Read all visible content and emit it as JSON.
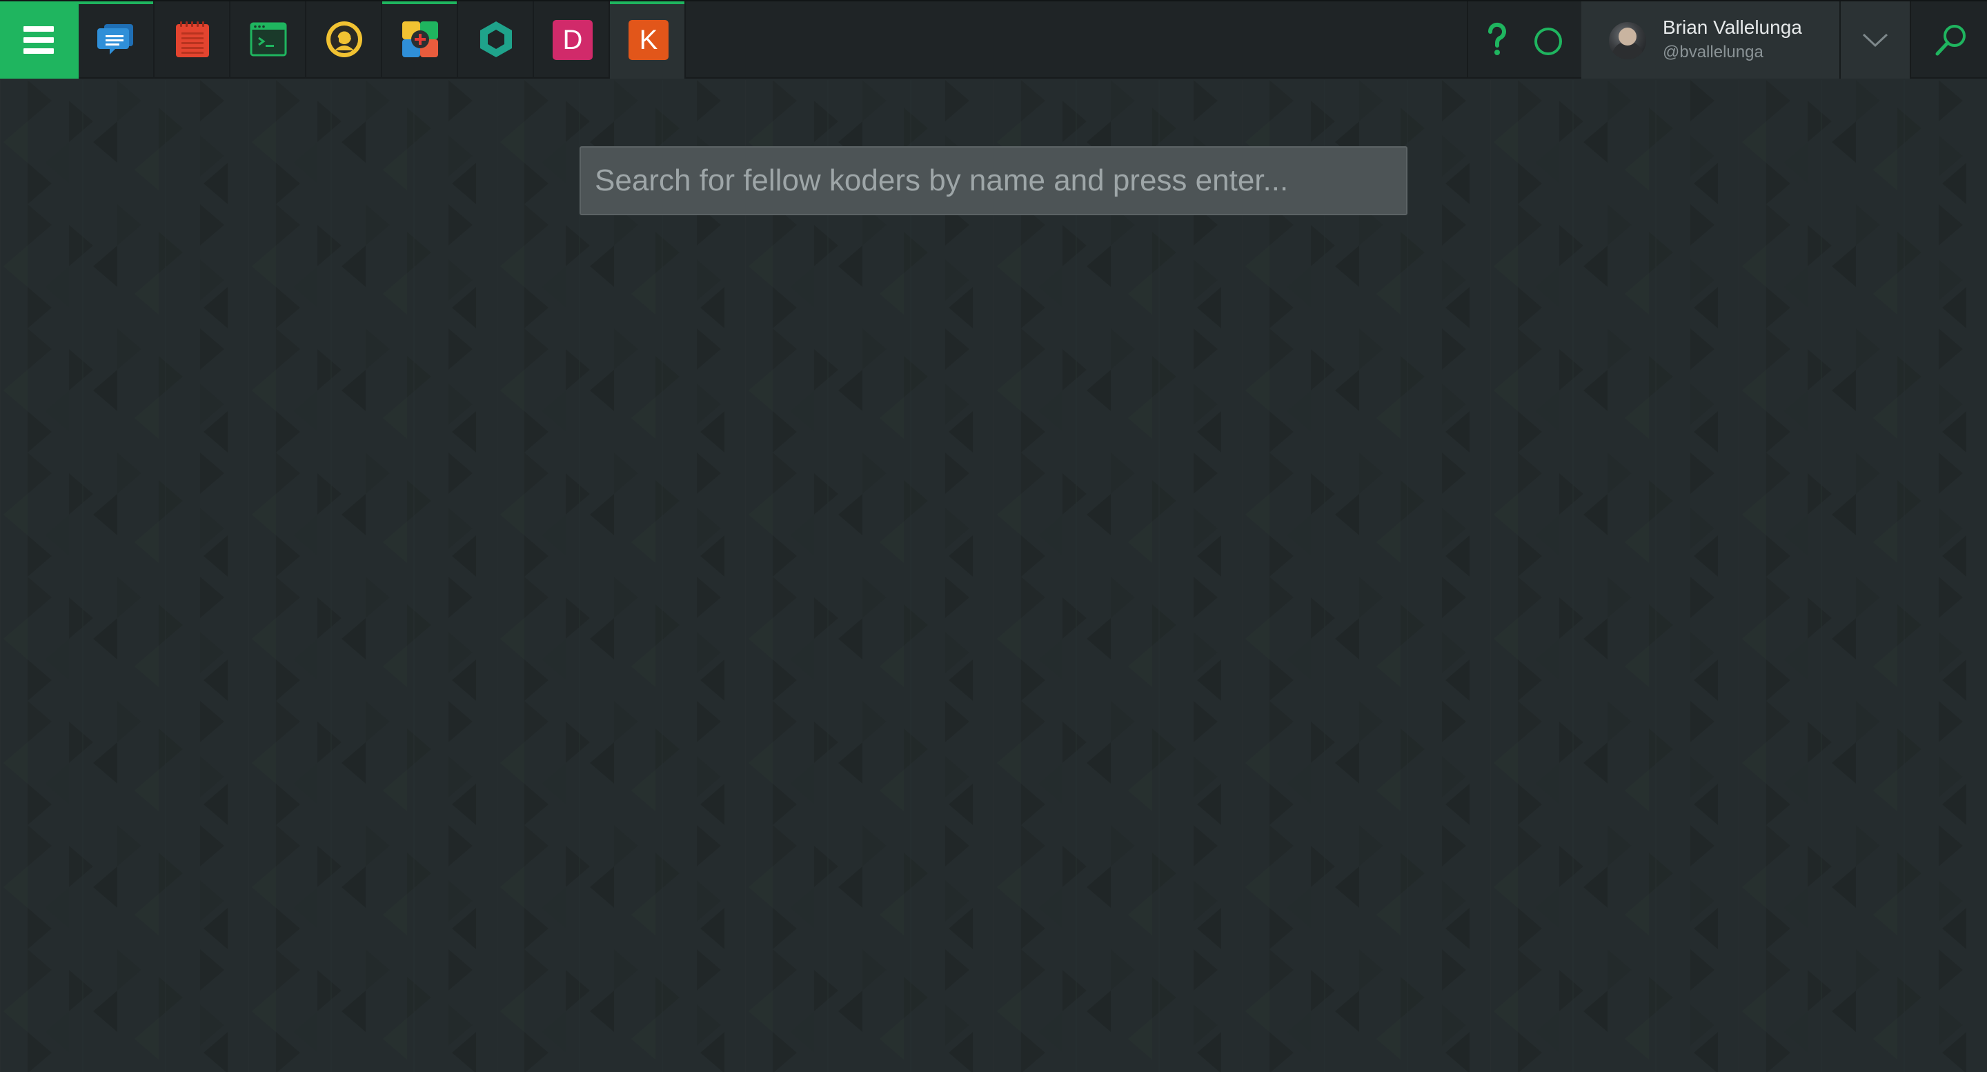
{
  "app": {
    "accent_color": "#1fb55f",
    "background_color": "#252c2e",
    "topbar_color": "#1f2426"
  },
  "menu": {
    "icon": "hamburger-menu-icon"
  },
  "apps": [
    {
      "name": "chat",
      "icon": "chat-bubble-icon",
      "color": "#2f8fd8",
      "active_line": true
    },
    {
      "name": "notes",
      "icon": "notepad-icon",
      "color": "#e3442f",
      "active_line": false
    },
    {
      "name": "terminal",
      "icon": "terminal-icon",
      "color": "#1fb55f",
      "active_line": false
    },
    {
      "name": "support",
      "icon": "headset-person-icon",
      "color": "#f1c232",
      "active_line": false
    },
    {
      "name": "add-app",
      "icon": "colorful-plus-icon",
      "color": "#e53935",
      "active_line": true
    },
    {
      "name": "hexagon",
      "icon": "hexagon-icon",
      "color": "#1fa38b",
      "active_line": false
    },
    {
      "name": "d-app",
      "icon": "letter-d-icon",
      "letter": "D",
      "color": "#d12a6a",
      "active_line": false
    },
    {
      "name": "k-app",
      "icon": "letter-k-icon",
      "letter": "K",
      "color": "#e2561a",
      "active_line": true,
      "selected": true
    }
  ],
  "header_right": {
    "help_icon": "question-mark-icon",
    "status_icon": "status-circle-icon",
    "dropdown_icon": "chevron-down-icon",
    "search_icon": "search-icon"
  },
  "user": {
    "name": "Brian Vallelunga",
    "handle": "@bvallelunga"
  },
  "search": {
    "placeholder": "Search for fellow koders by name and press enter...",
    "value": ""
  }
}
